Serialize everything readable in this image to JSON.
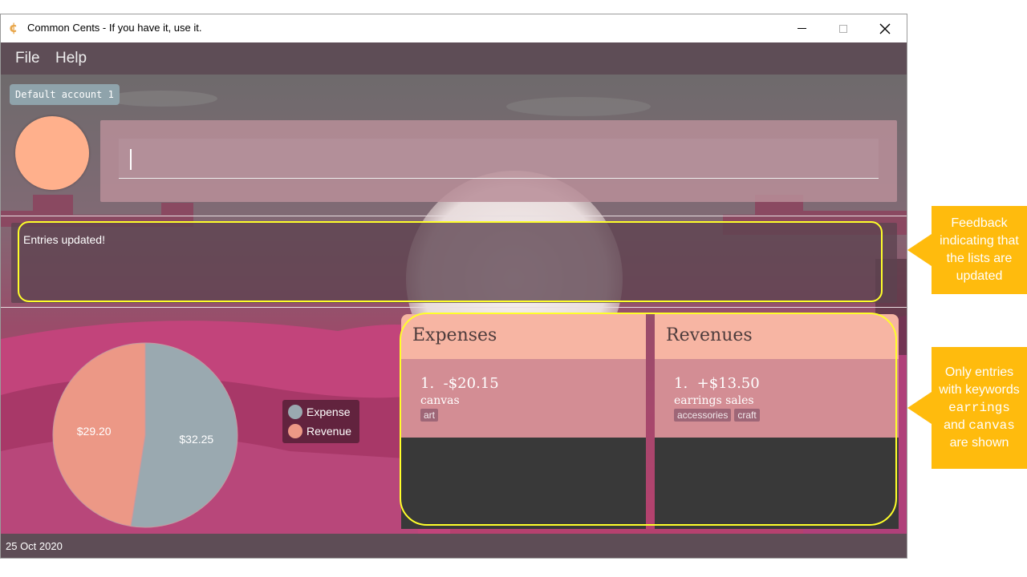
{
  "window": {
    "title": "Common Cents - If you have it, use it.",
    "app_icon_glyph": "¢"
  },
  "menubar": {
    "file": "File",
    "help": "Help"
  },
  "account": {
    "name": "Default account 1"
  },
  "command_box": {
    "value": ""
  },
  "feedback": {
    "message": "Entries updated!"
  },
  "pie_chart": {
    "slices": [
      {
        "name": "Expense",
        "value": 32.25,
        "label": "$32.25",
        "color": "#9aa9b0"
      },
      {
        "name": "Revenue",
        "value": 29.2,
        "label": "$29.20",
        "color": "#ec9886"
      }
    ]
  },
  "legend": {
    "expense": {
      "label": "Expense",
      "color": "#9aa9b0"
    },
    "revenue": {
      "label": "Revenue",
      "color": "#ec9886"
    }
  },
  "expenses": {
    "title": "Expenses",
    "entries": [
      {
        "index": "1.",
        "amount": "-$20.15",
        "description": "canvas",
        "tags": [
          "art"
        ]
      }
    ]
  },
  "revenues": {
    "title": "Revenues",
    "entries": [
      {
        "index": "1.",
        "amount": "+$13.50",
        "description": "earrings sales",
        "tags": [
          "accessories",
          "craft"
        ]
      }
    ]
  },
  "status": {
    "date": "25 Oct 2020"
  },
  "annotations": {
    "feedback_callout": "Feedback indicating that the lists are updated",
    "lists_callout": {
      "t1": "Only entries with keywords",
      "kw1": "earrings",
      "t2": "and",
      "kw2": "canvas",
      "t3": "are shown"
    },
    "highlight_color": "#ffff2a",
    "callout_color": "#ffbb0d"
  },
  "colors": {
    "menubar": "#5e4d56",
    "list_header": "#f7b5a3",
    "avatar": "#ffb08c"
  }
}
